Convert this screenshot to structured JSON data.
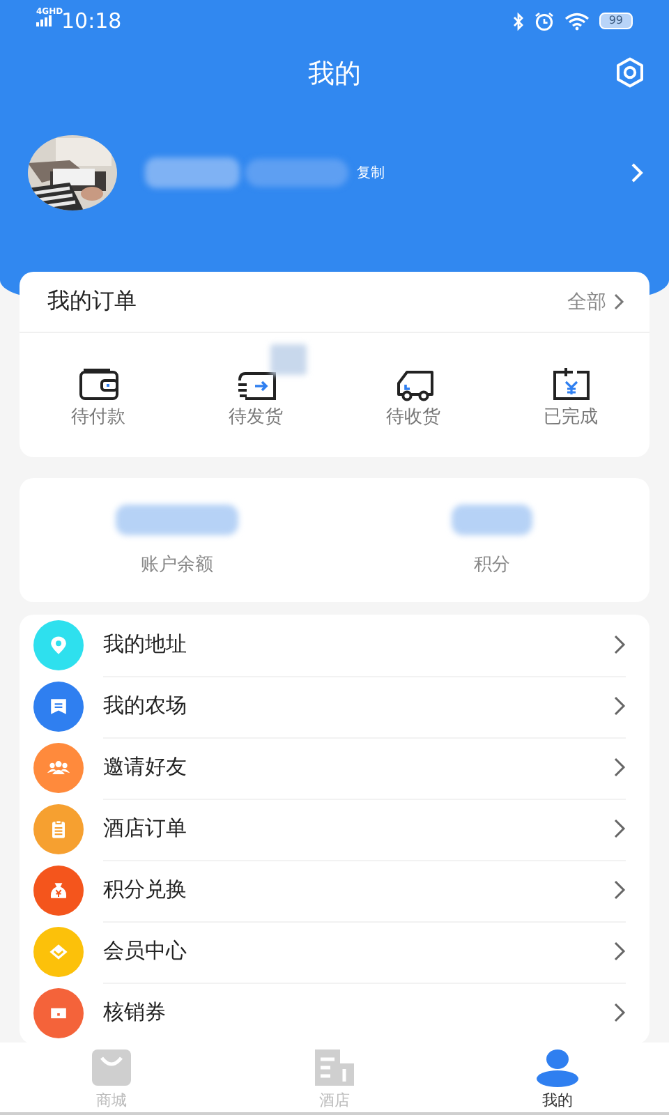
{
  "status_bar": {
    "network": "4GHD",
    "time": "10:18",
    "battery": "99"
  },
  "header": {
    "title": "我的"
  },
  "profile": {
    "copy_label": "复制"
  },
  "orders": {
    "title": "我的订单",
    "all_link": "全部",
    "items": [
      {
        "kind": "wallet",
        "label": "待付款"
      },
      {
        "kind": "shipping",
        "label": "待发货"
      },
      {
        "kind": "truck",
        "label": "待收货"
      },
      {
        "kind": "done",
        "label": "已完成"
      }
    ]
  },
  "account": {
    "items": [
      {
        "label": "账户余额"
      },
      {
        "label": "积分"
      }
    ]
  },
  "menu": [
    {
      "kind": "pin",
      "label": "我的地址",
      "color": "#2ee0ee"
    },
    {
      "kind": "farm",
      "label": "我的农场",
      "color": "#2f7ff0"
    },
    {
      "kind": "people",
      "label": "邀请好友",
      "color": "#ff8a3c"
    },
    {
      "kind": "clipboard",
      "label": "酒店订单",
      "color": "#f6a030"
    },
    {
      "kind": "moneybag",
      "label": "积分兑换",
      "color": "#f4551c"
    },
    {
      "kind": "diamond",
      "label": "会员中心",
      "color": "#fcc10a"
    },
    {
      "kind": "ticket",
      "label": "核销券",
      "color": "#f4633a"
    }
  ],
  "tabs": [
    {
      "kind": "shop",
      "label": "商城",
      "selected": false
    },
    {
      "kind": "hotel",
      "label": "酒店",
      "selected": false
    },
    {
      "kind": "user",
      "label": "我的",
      "selected": true
    }
  ]
}
